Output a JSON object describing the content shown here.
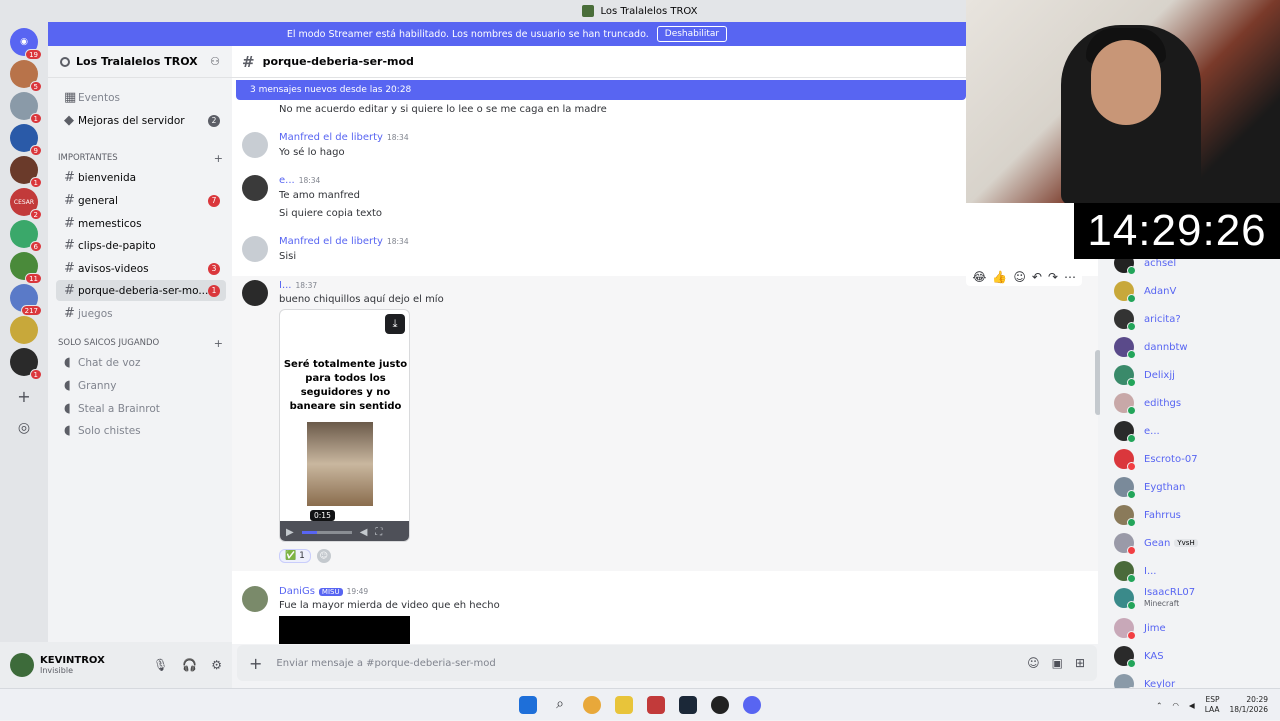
{
  "window": {
    "title": "Los Tralalelos TROX"
  },
  "streamer_bar": {
    "text": "El modo Streamer está habilitado. Los nombres de usuario se han truncado.",
    "button": "Deshabilitar"
  },
  "servers": [
    {
      "badge": "19"
    },
    {
      "badge": "5"
    },
    {
      "badge": "1"
    },
    {
      "badge": "9"
    },
    {
      "badge": "1"
    },
    {
      "label": "CESAR",
      "badge": "2"
    },
    {
      "badge": "6"
    },
    {
      "badge": "11"
    },
    {
      "badge": "217"
    },
    {
      "badge": ""
    },
    {
      "badge": "1"
    }
  ],
  "sidebar": {
    "server_name": "Los Tralalelos TROX",
    "events": "Eventos",
    "boosts": {
      "label": "Mejoras del servidor",
      "count": "2"
    },
    "cat1": "IMPORTANTES",
    "channels": [
      {
        "name": "bienvenida",
        "badge": ""
      },
      {
        "name": "general",
        "badge": "7"
      },
      {
        "name": "memesticos",
        "badge": ""
      },
      {
        "name": "clips-de-papito",
        "badge": ""
      },
      {
        "name": "avisos-videos",
        "badge": "3"
      },
      {
        "name": "porque-deberia-ser-mo...",
        "badge": "1"
      },
      {
        "name": "juegos",
        "badge": ""
      }
    ],
    "cat2": "SOLO SAICOS JUGANDO",
    "voice": [
      "Chat de voz",
      "Granny",
      "Steal a Brainrot",
      "Solo chistes"
    ]
  },
  "user": {
    "name": "KEVINTROX",
    "status": "Invisible"
  },
  "channel": {
    "name": "porque-deberia-ser-mod"
  },
  "new_messages": "3 mensajes nuevos desde las 20:28",
  "messages": [
    {
      "text": "No me acuerdo editar y si quiere lo lee o se me caga en la madre"
    },
    {
      "author": "Manfred el de liberty",
      "time": "18:34",
      "text": "Yo sé lo hago"
    },
    {
      "author": "e...",
      "time": "18:34",
      "text": "Te amo manfred",
      "text2": "Si quiere copia texto"
    },
    {
      "author": "Manfred el de liberty",
      "time": "18:34",
      "text": "Sisi"
    },
    {
      "author": "I...",
      "time": "18:37",
      "text": "bueno chiquillos aquí dejo el mío"
    },
    {
      "author": "DaniGs",
      "badge": "MISU",
      "time": "19:49",
      "text": "Fue la mayor mierda de video que eh hecho"
    }
  ],
  "video": {
    "caption": "Seré totalmente justo para todos los seguidores y no baneare sin sentido",
    "tooltip": "0:15",
    "progress": 0.3
  },
  "reaction": {
    "count": "1"
  },
  "composer": {
    "placeholder": "Enviar mensaje a #porque-deberia-ser-mod"
  },
  "clock": "14:29:26",
  "members": [
    {
      "name": "achsel",
      "status": "online"
    },
    {
      "name": "AdanV",
      "status": "online"
    },
    {
      "name": "aricita?",
      "status": "online"
    },
    {
      "name": "dannbtw",
      "status": "online"
    },
    {
      "name": "Delixjj",
      "status": "online"
    },
    {
      "name": "edithgs",
      "status": "online"
    },
    {
      "name": "e...",
      "status": "online"
    },
    {
      "name": "Escroto-07",
      "status": "dnd"
    },
    {
      "name": "Eygthan",
      "status": "online"
    },
    {
      "name": "Fahrrus",
      "status": "online"
    },
    {
      "name": "Gean",
      "tag": "YvsH",
      "status": "dnd"
    },
    {
      "name": "I...",
      "status": "online"
    },
    {
      "name": "IsaacRL07",
      "sub": "Minecraft",
      "status": "online"
    },
    {
      "name": "Jime",
      "status": "dnd"
    },
    {
      "name": "KAS",
      "status": "online"
    },
    {
      "name": "Keylor",
      "status": "online"
    }
  ],
  "tray": {
    "lang1": "ESP",
    "lang2": "LAA",
    "time": "20:29",
    "date": "18/1/2026"
  },
  "colors": {
    "blurple": "#5865f2",
    "red": "#da373c",
    "green": "#23a55a"
  }
}
